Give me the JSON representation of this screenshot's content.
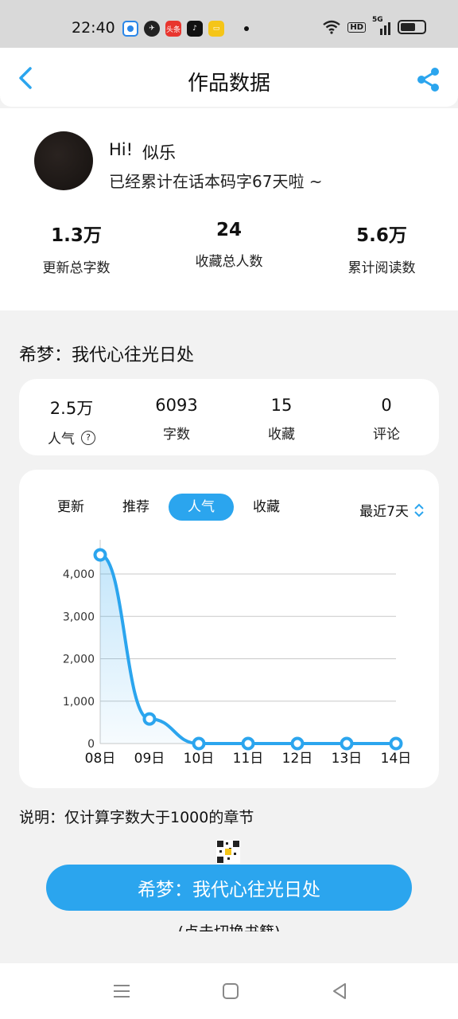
{
  "status_bar": {
    "time": "22:40",
    "app_badge_text": "头条",
    "network": "5G",
    "hd": "HD",
    "battery_level": 0.65
  },
  "header": {
    "title": "作品数据"
  },
  "profile": {
    "greeting": "Hi!",
    "name": "似乐",
    "subtitle": "已经累计在话本码字67天啦 ~",
    "stats": [
      {
        "value": "1.3万",
        "label": "更新总字数"
      },
      {
        "value": "24",
        "label": "收藏总人数"
      },
      {
        "value": "5.6万",
        "label": "累计阅读数"
      }
    ]
  },
  "book": {
    "title": "希梦：我代心往光日处",
    "stats": [
      {
        "value": "2.5万",
        "label": "人气"
      },
      {
        "value": "6093",
        "label": "字数"
      },
      {
        "value": "15",
        "label": "收藏"
      },
      {
        "value": "0",
        "label": "评论"
      }
    ],
    "help_glyph": "?"
  },
  "chart_tabs": [
    {
      "label": "更新",
      "active": false
    },
    {
      "label": "推荐",
      "active": false
    },
    {
      "label": "人气",
      "active": true
    },
    {
      "label": "收藏",
      "active": false
    }
  ],
  "range_select": "最近7天",
  "chart_data": {
    "type": "area",
    "categories": [
      "08日",
      "09日",
      "10日",
      "11日",
      "12日",
      "13日",
      "14日"
    ],
    "values": [
      4450,
      580,
      0,
      0,
      0,
      0,
      0
    ],
    "ylim": [
      0,
      4000
    ],
    "yticks": [
      "0",
      "1,000",
      "2,000",
      "3,000",
      "4,000"
    ],
    "grid": true,
    "series_color": "#2ba5ee"
  },
  "note": "说明：仅计算字数大于1000的章节",
  "cta": {
    "label": "希梦：我代心往光日处",
    "hint": "(点击切换书籍)"
  },
  "colors": {
    "accent": "#2ba5ee"
  }
}
